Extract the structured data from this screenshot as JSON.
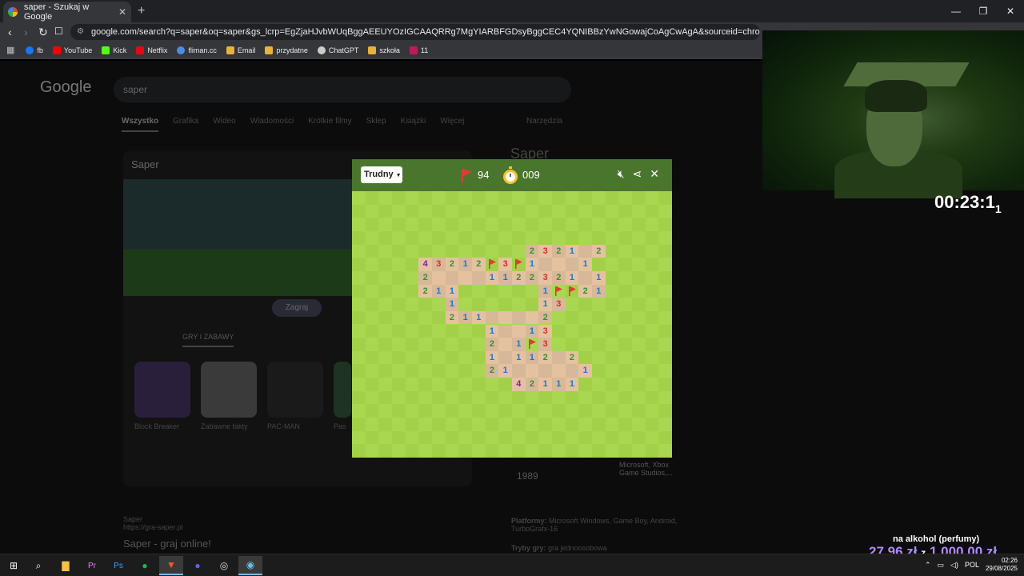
{
  "browser": {
    "tab_title": "saper - Szukaj w Google",
    "url": "google.com/search?q=saper&oq=saper&gs_lcrp=EgZjaHJvbWUqBggAEEUYOzIGCAAQRRg7MgYIARBFGDsyBggCEC4YQNIBBzYwNGowajCoAgCwAgA&sourceid=chrome&ie=UTF-8",
    "bookmarks": [
      {
        "label": "fb",
        "color": "#1877f2"
      },
      {
        "label": "YouTube",
        "color": "#ff0000"
      },
      {
        "label": "Kick",
        "color": "#53fc18"
      },
      {
        "label": "Netflix",
        "color": "#e50914"
      },
      {
        "label": "fliman.cc",
        "color": "#4a90e2"
      },
      {
        "label": "Email",
        "color": "#e8b339"
      },
      {
        "label": "przydatne",
        "color": "#e8b339"
      },
      {
        "label": "ChatGPT",
        "color": "#cccccc"
      },
      {
        "label": "szkoła",
        "color": "#e8b339"
      },
      {
        "label": "11",
        "color": "#c2185b"
      }
    ]
  },
  "google": {
    "logo": "Google",
    "query": "saper",
    "tabs": [
      "Wszystko",
      "Grafika",
      "Wideo",
      "Wiadomości",
      "Krótkie filmy",
      "Sklep",
      "Książki",
      "Więcej"
    ],
    "tools": "Narzędzia",
    "card_title": "Saper",
    "play": "Zagraj",
    "games_heading": "GRY I ZABAWY",
    "games": [
      "Block Breaker",
      "Zabawne fakty",
      "PAC-MAN",
      "Pas"
    ],
    "result_site": "Saper",
    "result_url": "https://gra-saper.pl",
    "result_title": "Saper - graj online!",
    "kp_title": "Saper",
    "kp_year": "1989",
    "kp_platforms_label": "Platformy:",
    "kp_platforms": "Microsoft Windows, Game Boy, Android,",
    "kp_platforms2": "TurboGrafx-16",
    "kp_modes_label": "Tryby gry:",
    "kp_modes": "gra jednoosobowa",
    "kp_dev": "Microsoft, Xbox Game Studios,..."
  },
  "game": {
    "difficulty": "Trudny",
    "flags": "94",
    "timer": "009",
    "colors": {
      "header": "#4a752c",
      "light": "#aad751",
      "dark": "#a2d149",
      "open_light": "#e5c29f",
      "open_dark": "#d7b899",
      "flag": "#e53935"
    },
    "number_colors": {
      "1": "#1976d2",
      "2": "#388e3c",
      "3": "#d32f2f",
      "4": "#7b1fa2"
    },
    "rows": [
      "..........................",
      "..........................",
      "..........................",
      "..........................",
      ".............2321.2.......",
      ".....43212F3F1...1........",
      ".....2....1122321.1.......",
      ".....211......1FF21.......",
      ".......1......13..........",
      ".......211....2...........",
      "..........1..13...........",
      "..........2.1F3...........",
      "..........1.112.2.........",
      "..........21.....1........",
      "............42111.........",
      "..........................",
      "..........................",
      "..........................",
      "..........................",
      ".........................."
    ]
  },
  "overlays": {
    "speedrun": "00:23:1",
    "speedrun_ms": "1",
    "goal_title": "na alkohol (perfumy)",
    "goal_current": "27,96 zł",
    "goal_z": "z",
    "goal_target": "1 000,00 zł"
  },
  "taskbar": {
    "apps": [
      "windows-icon",
      "search-icon",
      "file-explorer-icon",
      "premiere-icon",
      "photoshop-icon",
      "spotify-icon",
      "brave-icon",
      "discord-icon",
      "obs-icon",
      "steam-icon"
    ],
    "lang": "POL",
    "time": "02:26",
    "date": "29/08/2025"
  }
}
